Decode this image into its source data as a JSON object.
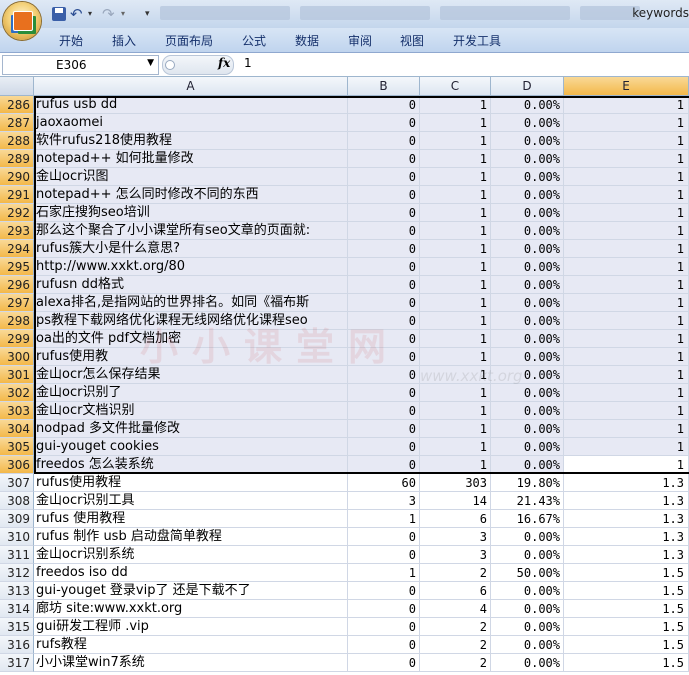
{
  "titlebar": {
    "title": "keywords"
  },
  "ribbon": {
    "tabs": [
      "开始",
      "插入",
      "页面布局",
      "公式",
      "数据",
      "审阅",
      "视图",
      "开发工具"
    ]
  },
  "formula_bar": {
    "name_box": "E306",
    "fx": "fx",
    "value": "1"
  },
  "columns": [
    "A",
    "B",
    "C",
    "D",
    "E"
  ],
  "watermark": {
    "text": "小小课堂网",
    "url": "www.xxkt.org"
  },
  "rows": [
    {
      "n": "286",
      "a": "rufus usb dd",
      "b": "0",
      "c": "1",
      "d": "0.00%",
      "e": "1"
    },
    {
      "n": "287",
      "a": "jaoxaomei",
      "b": "0",
      "c": "1",
      "d": "0.00%",
      "e": "1"
    },
    {
      "n": "288",
      "a": "软件rufus218使用教程",
      "b": "0",
      "c": "1",
      "d": "0.00%",
      "e": "1"
    },
    {
      "n": "289",
      "a": "notepad++ 如何批量修改",
      "b": "0",
      "c": "1",
      "d": "0.00%",
      "e": "1"
    },
    {
      "n": "290",
      "a": "金山ocr识图",
      "b": "0",
      "c": "1",
      "d": "0.00%",
      "e": "1"
    },
    {
      "n": "291",
      "a": "notepad++ 怎么同时修改不同的东西",
      "b": "0",
      "c": "1",
      "d": "0.00%",
      "e": "1"
    },
    {
      "n": "292",
      "a": "石家庄搜狗seo培训",
      "b": "0",
      "c": "1",
      "d": "0.00%",
      "e": "1"
    },
    {
      "n": "293",
      "a": "那么这个聚合了小小课堂所有seo文章的页面就:",
      "b": "0",
      "c": "1",
      "d": "0.00%",
      "e": "1"
    },
    {
      "n": "294",
      "a": "rufus簇大小是什么意思?",
      "b": "0",
      "c": "1",
      "d": "0.00%",
      "e": "1"
    },
    {
      "n": "295",
      "a": "http://www.xxkt.org/80",
      "b": "0",
      "c": "1",
      "d": "0.00%",
      "e": "1"
    },
    {
      "n": "296",
      "a": "rufusn dd格式",
      "b": "0",
      "c": "1",
      "d": "0.00%",
      "e": "1"
    },
    {
      "n": "297",
      "a": "alexa排名,是指网站的世界排名。如同《福布斯",
      "b": "0",
      "c": "1",
      "d": "0.00%",
      "e": "1"
    },
    {
      "n": "298",
      "a": "ps教程下载网络优化课程无线网络优化课程seo",
      "b": "0",
      "c": "1",
      "d": "0.00%",
      "e": "1"
    },
    {
      "n": "299",
      "a": "oa出的文件 pdf文档加密",
      "b": "0",
      "c": "1",
      "d": "0.00%",
      "e": "1"
    },
    {
      "n": "300",
      "a": "rufus使用教",
      "b": "0",
      "c": "1",
      "d": "0.00%",
      "e": "1"
    },
    {
      "n": "301",
      "a": "金山ocr怎么保存结果",
      "b": "0",
      "c": "1",
      "d": "0.00%",
      "e": "1"
    },
    {
      "n": "302",
      "a": "金山ocr识别了",
      "b": "0",
      "c": "1",
      "d": "0.00%",
      "e": "1"
    },
    {
      "n": "303",
      "a": "金山ocr文档识别",
      "b": "0",
      "c": "1",
      "d": "0.00%",
      "e": "1"
    },
    {
      "n": "304",
      "a": "nodpad 多文件批量修改",
      "b": "0",
      "c": "1",
      "d": "0.00%",
      "e": "1"
    },
    {
      "n": "305",
      "a": "gui-youget cookies",
      "b": "0",
      "c": "1",
      "d": "0.00%",
      "e": "1"
    },
    {
      "n": "306",
      "a": "freedos 怎么装系统",
      "b": "0",
      "c": "1",
      "d": "0.00%",
      "e": "1"
    },
    {
      "n": "307",
      "a": "rufus使用教程",
      "b": "60",
      "c": "303",
      "d": "19.80%",
      "e": "1.3"
    },
    {
      "n": "308",
      "a": "金山ocr识别工具",
      "b": "3",
      "c": "14",
      "d": "21.43%",
      "e": "1.3"
    },
    {
      "n": "309",
      "a": "rufus 使用教程",
      "b": "1",
      "c": "6",
      "d": "16.67%",
      "e": "1.3"
    },
    {
      "n": "310",
      "a": "rufus 制作 usb 启动盘简单教程",
      "b": "0",
      "c": "3",
      "d": "0.00%",
      "e": "1.3"
    },
    {
      "n": "311",
      "a": "金山ocr识别系统",
      "b": "0",
      "c": "3",
      "d": "0.00%",
      "e": "1.3"
    },
    {
      "n": "312",
      "a": "freedos iso dd",
      "b": "1",
      "c": "2",
      "d": "50.00%",
      "e": "1.5"
    },
    {
      "n": "313",
      "a": "gui-youget 登录vip了 还是下载不了",
      "b": "0",
      "c": "6",
      "d": "0.00%",
      "e": "1.5"
    },
    {
      "n": "314",
      "a": "廊坊 site:www.xxkt.org",
      "b": "0",
      "c": "4",
      "d": "0.00%",
      "e": "1.5"
    },
    {
      "n": "315",
      "a": "gui研发工程师 .vip",
      "b": "0",
      "c": "2",
      "d": "0.00%",
      "e": "1.5"
    },
    {
      "n": "316",
      "a": "rufs教程",
      "b": "0",
      "c": "2",
      "d": "0.00%",
      "e": "1.5"
    },
    {
      "n": "317",
      "a": "小小课堂win7系统",
      "b": "0",
      "c": "2",
      "d": "0.00%",
      "e": "1.5"
    }
  ]
}
